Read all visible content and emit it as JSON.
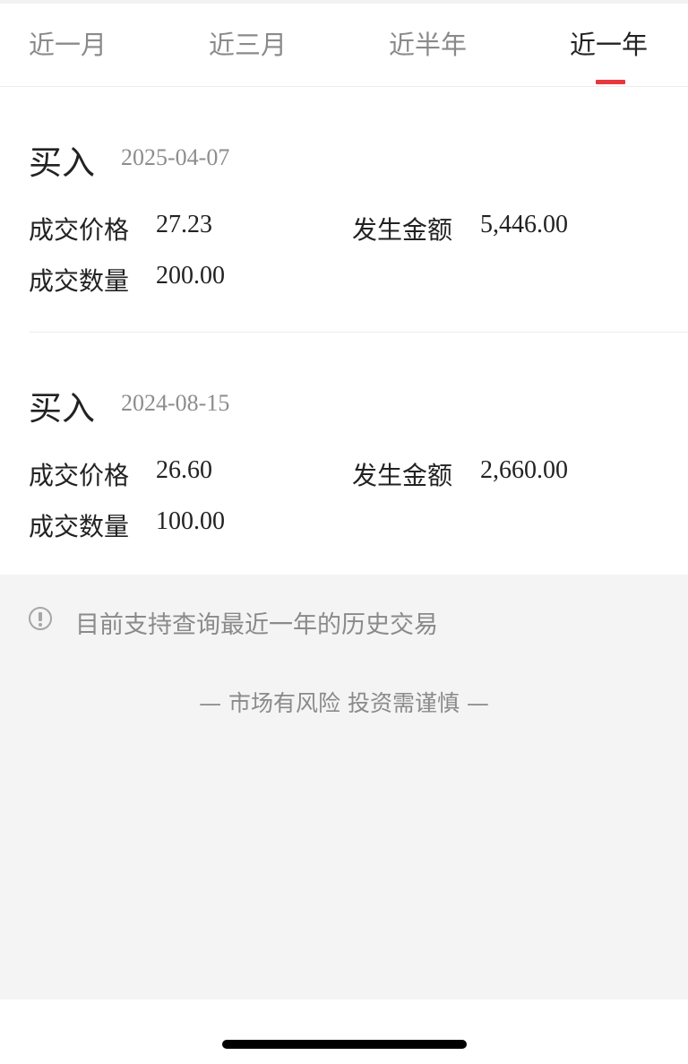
{
  "tabs": [
    {
      "label": "近一月",
      "active": false
    },
    {
      "label": "近三月",
      "active": false
    },
    {
      "label": "近半年",
      "active": false
    },
    {
      "label": "近一年",
      "active": true
    }
  ],
  "records": [
    {
      "type": "买入",
      "date": "2025-04-07",
      "price_label": "成交价格",
      "price": "27.23",
      "amount_label": "发生金额",
      "amount": "5,446.00",
      "quantity_label": "成交数量",
      "quantity": "200.00"
    },
    {
      "type": "买入",
      "date": "2024-08-15",
      "price_label": "成交价格",
      "price": "26.60",
      "amount_label": "发生金额",
      "amount": "2,660.00",
      "quantity_label": "成交数量",
      "quantity": "100.00"
    }
  ],
  "footer": {
    "icon": "info-circle-icon",
    "notice": "目前支持查询最近一年的历史交易",
    "disclaimer": "— 市场有风险 投资需谨慎 —"
  },
  "colors": {
    "accent": "#e8383d",
    "background_gray": "#f4f4f4",
    "text_primary": "#222222",
    "text_secondary": "#8a8a8a"
  }
}
